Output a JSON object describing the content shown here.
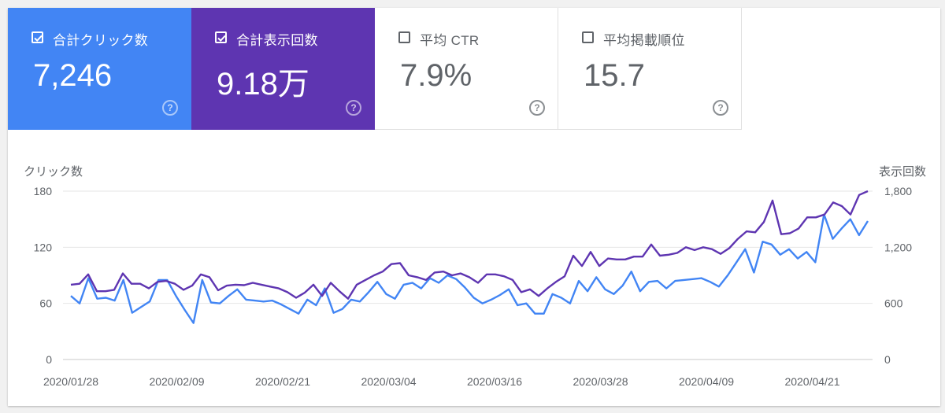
{
  "cards": [
    {
      "label": "合計クリック数",
      "value": "7,246",
      "checked": true,
      "color": "#4285f4"
    },
    {
      "label": "合計表示回数",
      "value": "9.18万",
      "checked": true,
      "color": "#5e35b1"
    },
    {
      "label": "平均 CTR",
      "value": "7.9%",
      "checked": false,
      "color": "#ffffff"
    },
    {
      "label": "平均掲載順位",
      "value": "15.7",
      "checked": false,
      "color": "#ffffff"
    }
  ],
  "help_glyph": "?",
  "chart_data": {
    "type": "line",
    "left_axis_label": "クリック数",
    "right_axis_label": "表示回数",
    "left_ticks": [
      "0",
      "60",
      "120",
      "180"
    ],
    "right_ticks": [
      "0",
      "600",
      "1,200",
      "1,800"
    ],
    "left_ylim": [
      0,
      180
    ],
    "right_ylim": [
      0,
      1800
    ],
    "x_tick_labels": [
      "2020/01/28",
      "2020/02/09",
      "2020/02/21",
      "2020/03/04",
      "2020/03/16",
      "2020/03/28",
      "2020/04/09",
      "2020/04/21"
    ],
    "grid": true,
    "series": [
      {
        "axis": "left",
        "color": "#4285f4",
        "values": [
          68,
          60,
          87,
          65,
          66,
          63,
          85,
          50,
          56,
          62,
          85,
          85,
          68,
          53,
          39,
          85,
          61,
          60,
          68,
          75,
          64,
          63,
          62,
          63,
          59,
          54,
          49,
          64,
          58,
          76,
          50,
          54,
          64,
          62,
          72,
          83,
          70,
          65,
          80,
          82,
          76,
          87,
          82,
          90,
          86,
          77,
          66,
          60,
          64,
          69,
          75,
          58,
          60,
          49,
          49,
          70,
          66,
          60,
          84,
          73,
          88,
          75,
          70,
          79,
          94,
          73,
          83,
          84,
          76,
          84,
          85,
          86,
          87,
          83,
          78,
          90,
          104,
          118,
          93,
          126,
          123,
          112,
          118,
          108,
          115,
          104,
          155,
          129,
          140,
          150,
          133,
          148
        ]
      },
      {
        "axis": "right",
        "color": "#5e35b1",
        "values": [
          800,
          810,
          910,
          730,
          730,
          745,
          920,
          810,
          810,
          760,
          830,
          840,
          810,
          745,
          790,
          910,
          880,
          740,
          790,
          800,
          795,
          820,
          800,
          780,
          760,
          720,
          660,
          715,
          800,
          680,
          820,
          730,
          650,
          800,
          850,
          900,
          940,
          1020,
          1030,
          900,
          880,
          850,
          930,
          940,
          900,
          920,
          880,
          820,
          910,
          910,
          890,
          850,
          720,
          750,
          680,
          760,
          830,
          890,
          1110,
          1000,
          1150,
          1000,
          1080,
          1070,
          1070,
          1100,
          1100,
          1230,
          1110,
          1120,
          1140,
          1200,
          1170,
          1200,
          1180,
          1130,
          1190,
          1290,
          1370,
          1360,
          1470,
          1700,
          1340,
          1350,
          1400,
          1520,
          1520,
          1550,
          1680,
          1640,
          1550,
          1760,
          1800
        ]
      }
    ]
  }
}
